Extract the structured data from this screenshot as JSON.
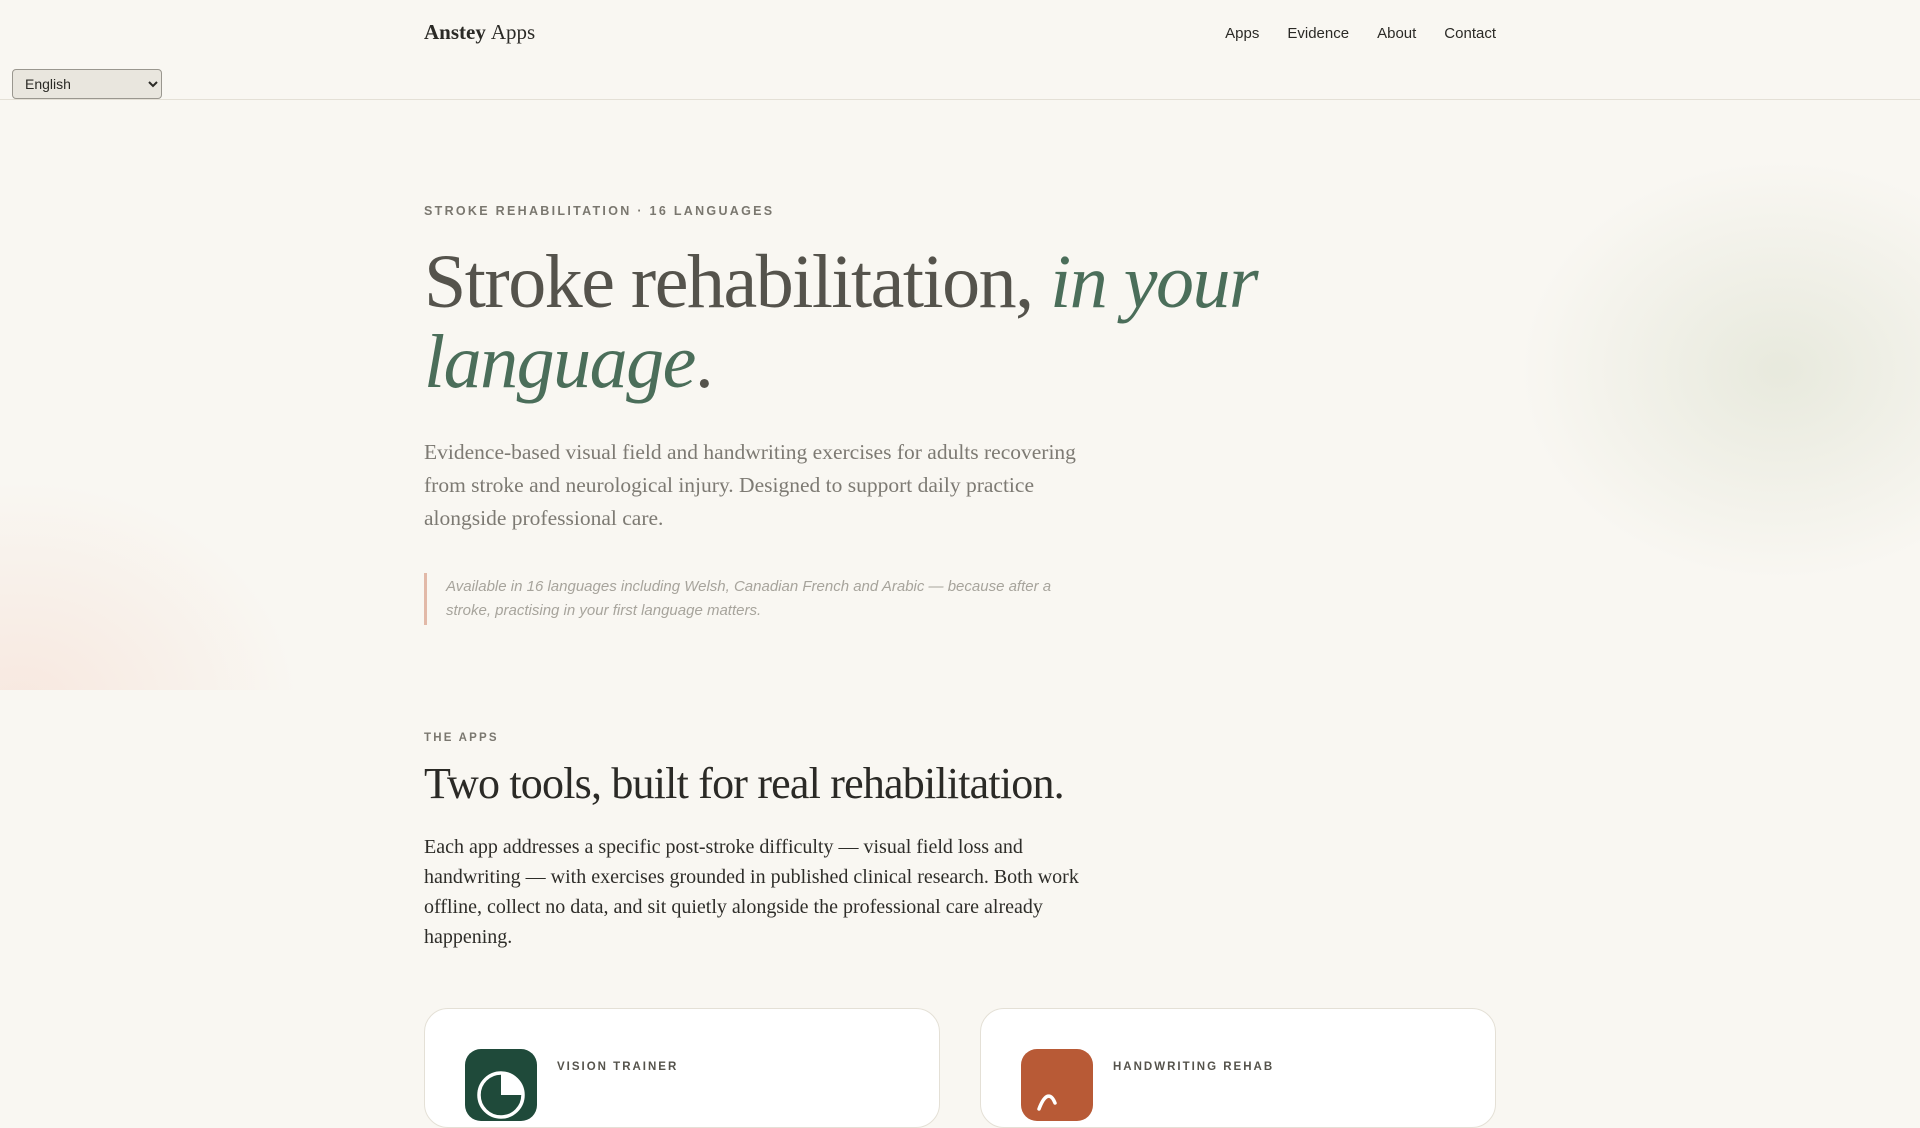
{
  "header": {
    "brand_strong": "Anstey",
    "brand_light": "Apps",
    "nav": [
      {
        "label": "Apps"
      },
      {
        "label": "Evidence"
      },
      {
        "label": "About"
      },
      {
        "label": "Contact"
      }
    ],
    "language_select": {
      "value": "English",
      "options": [
        "English"
      ]
    }
  },
  "hero": {
    "eyebrow": "STROKE REHABILITATION · 16 LANGUAGES",
    "title_plain": "Stroke rehabilitation, ",
    "title_em": "in your language",
    "title_end": ".",
    "description": "Evidence-based visual field and handwriting exercises for adults recovering from stroke and neurological injury. Designed to support daily practice alongside professional care.",
    "note": "Available in 16 languages including Welsh, Canadian French and Arabic — because after a stroke, practising in your first language matters."
  },
  "apps_section": {
    "eyebrow": "THE APPS",
    "title": "Two tools, built for real rehabilitation.",
    "description": "Each app addresses a specific post-stroke difficulty — visual field loss and handwriting — with exercises grounded in published clinical research. Both work offline, collect no data, and sit quietly alongside the professional care already happening.",
    "cards": [
      {
        "eyebrow": "VISION TRAINER",
        "icon": "vision-icon",
        "color": "#1f4a3a"
      },
      {
        "eyebrow": "HANDWRITING REHAB",
        "icon": "handwriting-icon",
        "color": "#b85a36"
      }
    ]
  },
  "colors": {
    "background": "#f9f7f2",
    "accent_green": "#4b6e5a",
    "accent_terracotta": "#e2b9a8"
  }
}
